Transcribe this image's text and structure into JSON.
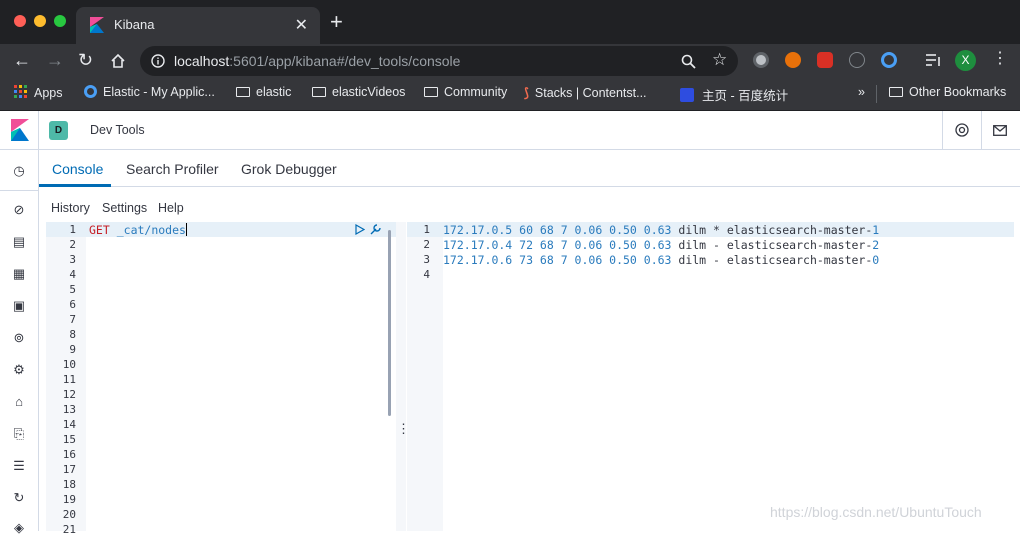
{
  "browser": {
    "tab_title": "Kibana",
    "url_host": "localhost",
    "url_path": ":5601/app/kibana#/dev_tools/console",
    "profile_initial": "X",
    "bookmarks": [
      "Apps",
      "Elastic - My Applic...",
      "elastic",
      "elasticVideos",
      "Community",
      "Stacks | Contentst...",
      "主页 - 百度统计"
    ],
    "bookmarks_overflow": "»",
    "other_bookmarks": "Other Bookmarks"
  },
  "kibana": {
    "space_initial": "D",
    "app_title": "Dev Tools",
    "tabs": [
      "Console",
      "Search Profiler",
      "Grok Debugger"
    ],
    "menu": [
      "History",
      "Settings",
      "Help"
    ]
  },
  "request": {
    "method": "GET",
    "path": "_cat/nodes",
    "line_numbers": [
      "1",
      "2",
      "3",
      "4",
      "5",
      "6",
      "7",
      "8",
      "9",
      "10",
      "11",
      "12",
      "13",
      "14",
      "15",
      "16",
      "17",
      "18",
      "19",
      "20",
      "21"
    ]
  },
  "response": {
    "line_numbers": [
      "1",
      "2",
      "3",
      "4"
    ],
    "lines": [
      {
        "nums": "172.17.0.5 60 68 7 0.06 0.50 0.63",
        "rest": " dilm * elasticsearch-master-",
        "tail": "1"
      },
      {
        "nums": "172.17.0.4 72 68 7 0.06 0.50 0.63",
        "rest": " dilm - elasticsearch-master-",
        "tail": "2"
      },
      {
        "nums": "172.17.0.6 73 68 7 0.06 0.50 0.63",
        "rest": " dilm - elasticsearch-master-",
        "tail": "0"
      }
    ]
  },
  "watermark": "https://blog.csdn.net/UbuntuTouch",
  "colors": {
    "accent": "#006bb4",
    "space_badge": "#4eb9a8",
    "number_blue": "#2a7bbd",
    "method_red": "#c61e25"
  }
}
